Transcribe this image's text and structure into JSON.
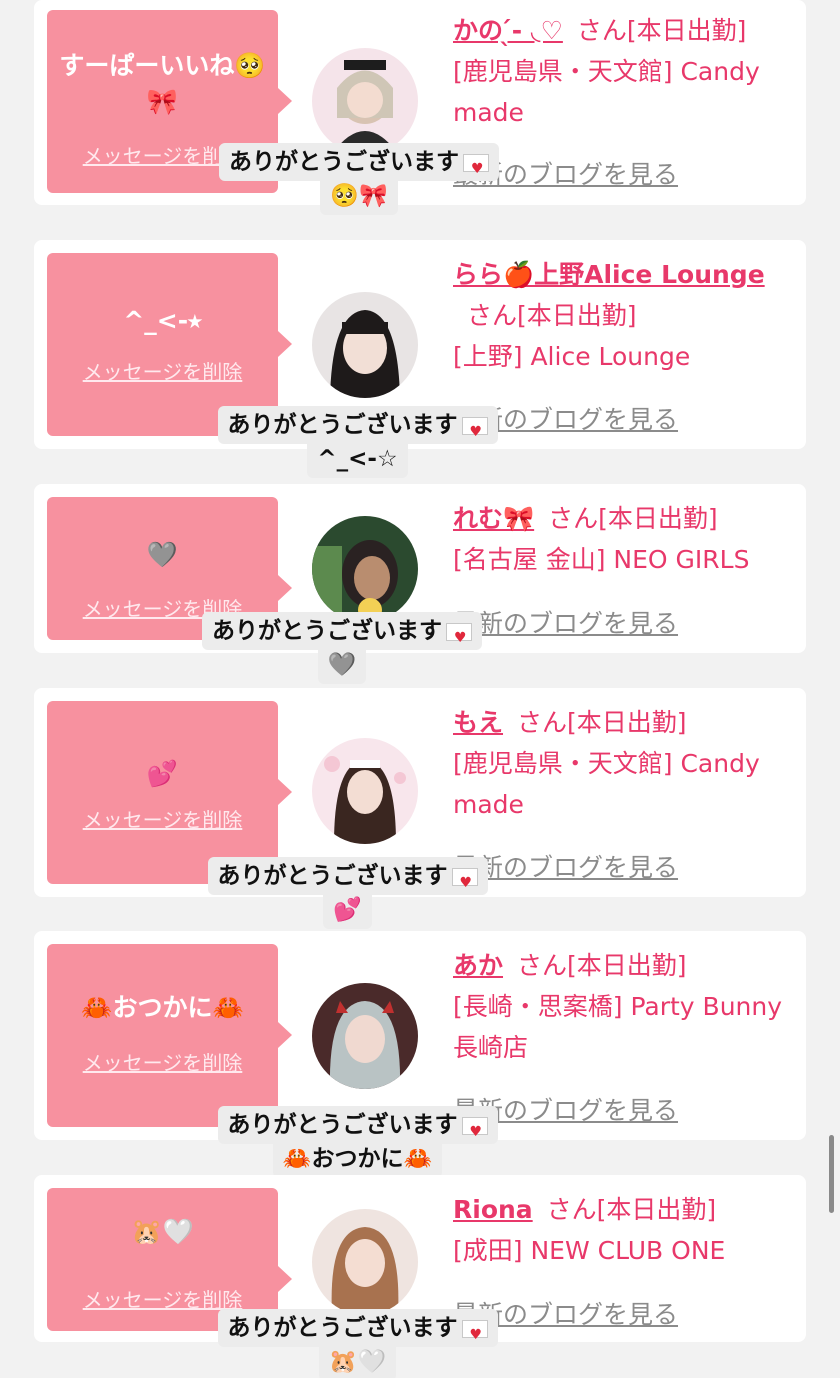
{
  "delete_label": "メッセージを削除",
  "blog_label": "最新のブログを見る",
  "reply_text": "ありがとうございます",
  "san_suffix": "さん[本日出勤]",
  "colors": {
    "background": "#f2f2f2",
    "bubble": "#f7919f",
    "accent": "#e8386a",
    "muted": "#8b8b8b"
  },
  "entries": [
    {
      "message": "すーぱーいいね🥺🎀",
      "name": "かの ̖́-‬ ◟♡",
      "shop": "[鹿児島県・天文館] Candy made",
      "reply_line2": "🥺🎀"
    },
    {
      "message": "^_<-⭑",
      "name": "らら🍎上野Alice Lounge",
      "shop": "[上野] Alice Lounge",
      "reply_line2": "^_<-☆"
    },
    {
      "message": "🩶",
      "name": "れむ🎀",
      "shop": "[名古屋 金山] NEO GIRLS",
      "reply_line2": "🩶"
    },
    {
      "message": "💕",
      "name": "もえ",
      "shop": "[鹿児島県・天文館] Candy made",
      "reply_line2": "💕"
    },
    {
      "message": "🦀おつかに🦀",
      "name": "あか",
      "shop": "[長崎・思案橋] Party Bunny 長崎店",
      "reply_line2": "🦀おつかに🦀"
    },
    {
      "message": "🐹🤍",
      "name": "Riona",
      "shop": "[成田] NEW CLUB ONE",
      "reply_line2": "🐹🤍"
    }
  ]
}
